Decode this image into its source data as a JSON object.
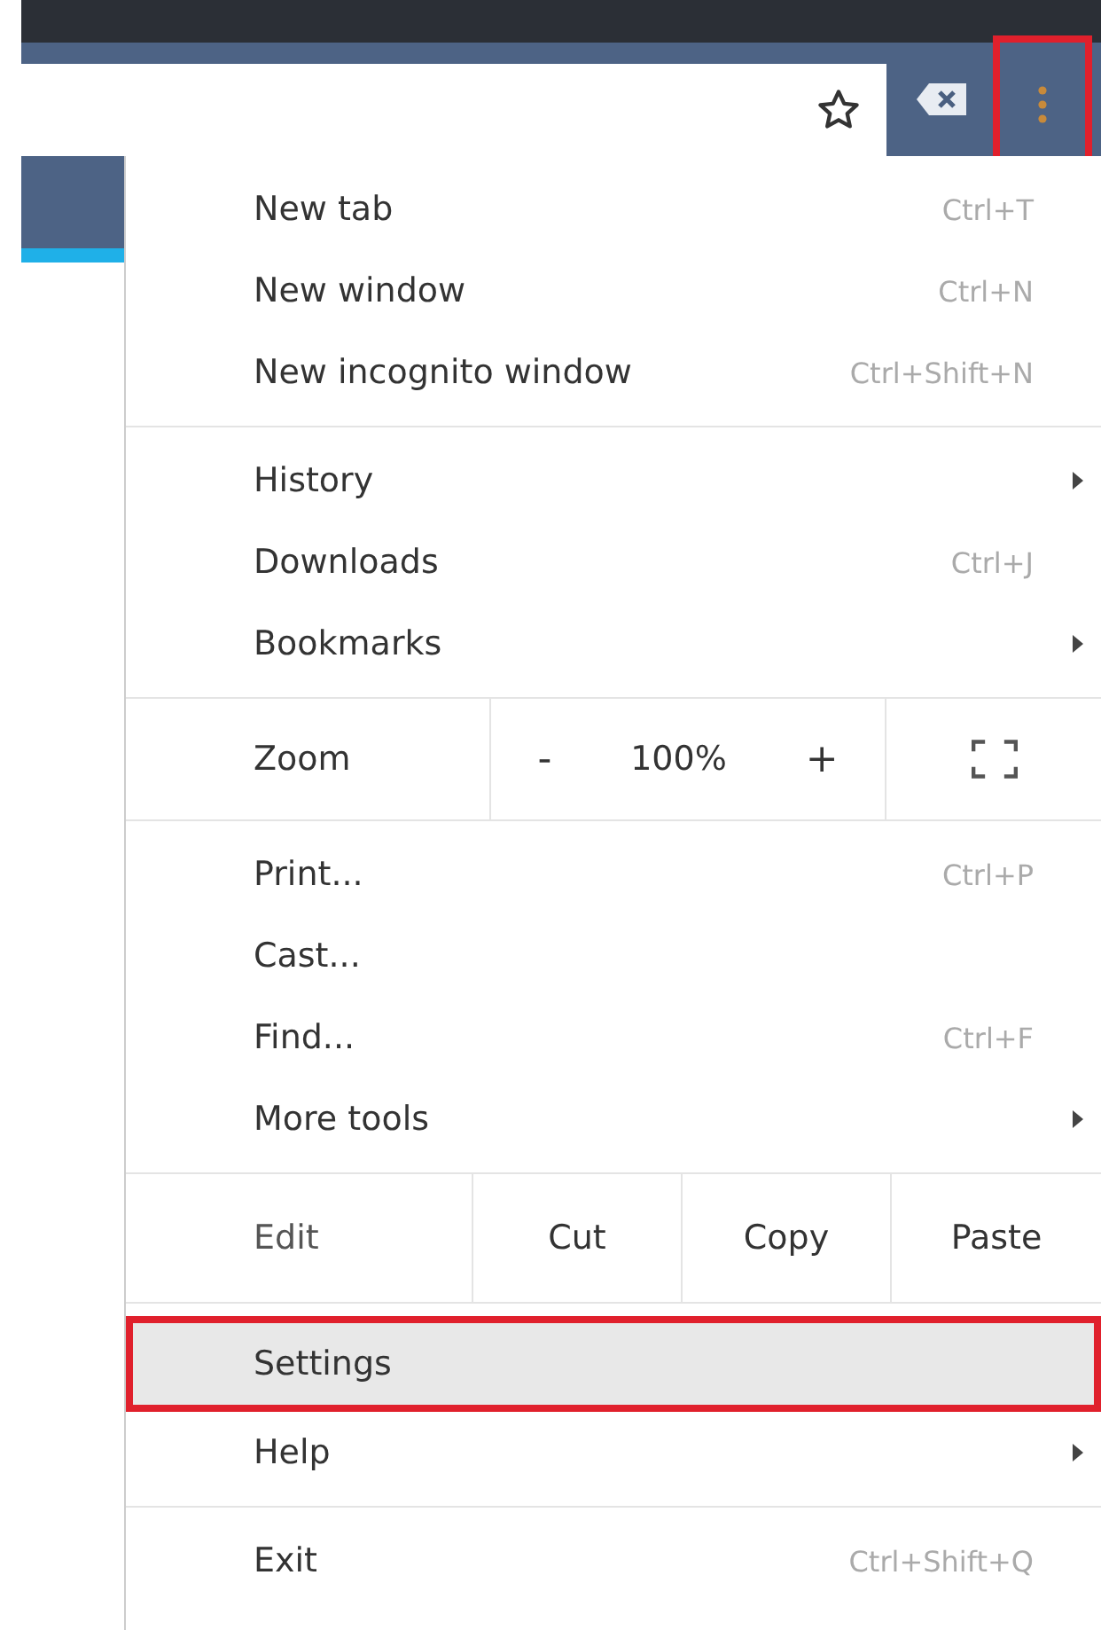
{
  "toolbar": {
    "menu_button": {
      "highlighted": true
    }
  },
  "menu": {
    "sections": [
      {
        "kind": "items",
        "items": [
          {
            "label": "New tab",
            "shortcut": "Ctrl+T",
            "submenu": false,
            "hovered": false,
            "highlighted": false
          },
          {
            "label": "New window",
            "shortcut": "Ctrl+N",
            "submenu": false,
            "hovered": false,
            "highlighted": false
          },
          {
            "label": "New incognito window",
            "shortcut": "Ctrl+Shift+N",
            "submenu": false,
            "hovered": false,
            "highlighted": false
          }
        ]
      },
      {
        "kind": "items",
        "items": [
          {
            "label": "History",
            "submenu": true,
            "hovered": false,
            "highlighted": false
          },
          {
            "label": "Downloads",
            "shortcut": "Ctrl+J",
            "submenu": false,
            "hovered": false,
            "highlighted": false
          },
          {
            "label": "Bookmarks",
            "submenu": true,
            "hovered": false,
            "highlighted": false
          }
        ]
      },
      {
        "kind": "zoom",
        "label": "Zoom",
        "minus": "-",
        "value": "100%",
        "plus": "+"
      },
      {
        "kind": "items",
        "items": [
          {
            "label": "Print...",
            "shortcut": "Ctrl+P",
            "submenu": false,
            "hovered": false,
            "highlighted": false
          },
          {
            "label": "Cast...",
            "submenu": false,
            "hovered": false,
            "highlighted": false
          },
          {
            "label": "Find...",
            "shortcut": "Ctrl+F",
            "submenu": false,
            "hovered": false,
            "highlighted": false
          },
          {
            "label": "More tools",
            "submenu": true,
            "hovered": false,
            "highlighted": false
          }
        ]
      },
      {
        "kind": "edit",
        "label": "Edit",
        "buttons": [
          "Cut",
          "Copy",
          "Paste"
        ]
      },
      {
        "kind": "items",
        "items": [
          {
            "label": "Settings",
            "submenu": false,
            "hovered": true,
            "highlighted": true
          },
          {
            "label": "Help",
            "submenu": true,
            "hovered": false,
            "highlighted": false
          }
        ]
      },
      {
        "kind": "items",
        "items": [
          {
            "label": "Exit",
            "shortcut": "Ctrl+Shift+Q",
            "submenu": false,
            "hovered": false,
            "highlighted": false
          }
        ]
      }
    ]
  }
}
